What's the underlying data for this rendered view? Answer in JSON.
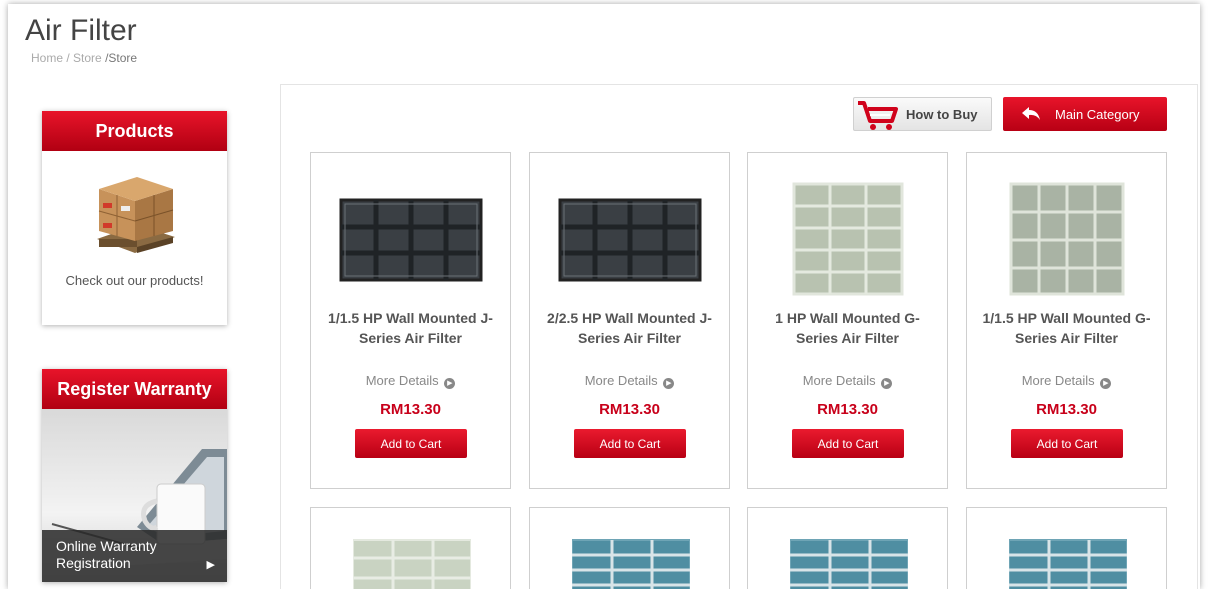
{
  "page": {
    "title": "Air Filter",
    "breadcrumb": {
      "home": "Home",
      "sep1": "/",
      "store": "Store",
      "current": "/Store"
    }
  },
  "sidebar": {
    "products": {
      "title": "Products",
      "caption": "Check out our products!"
    },
    "warranty": {
      "title": "Register Warranty",
      "line1": "Online Warranty",
      "line2": "Registration",
      "arrow": "▶"
    }
  },
  "toolbar": {
    "how_to_buy": "How to Buy",
    "main_category": "Main Category"
  },
  "colors": {
    "accent": "#cc0a1e",
    "filter_dark": "#2d3135",
    "filter_light": "#c5cdbf",
    "filter_blue": "#4f8ea2"
  },
  "products": [
    {
      "name": "1/1.5 HP Wall Mounted J-Series Air Filter",
      "more": "More Details",
      "price": "RM13.30",
      "add": "Add to Cart",
      "image": "dark-filter"
    },
    {
      "name": "2/2.5 HP Wall Mounted J-Series Air Filter",
      "more": "More Details",
      "price": "RM13.30",
      "add": "Add to Cart",
      "image": "dark-filter"
    },
    {
      "name": "1 HP Wall Mounted G-Series Air Filter",
      "more": "More Details",
      "price": "RM13.30",
      "add": "Add to Cart",
      "image": "light-filter"
    },
    {
      "name": "1/1.5 HP Wall Mounted G-Series Air Filter",
      "more": "More Details",
      "price": "RM13.30",
      "add": "Add to Cart",
      "image": "light-filter"
    }
  ]
}
